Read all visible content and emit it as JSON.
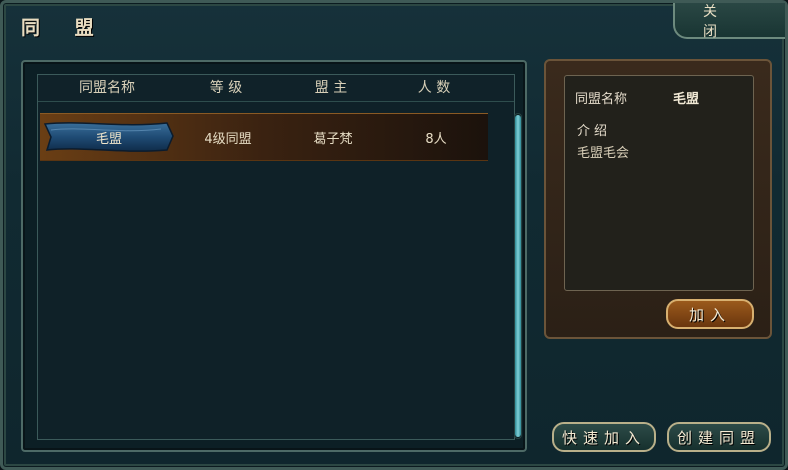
{
  "window": {
    "title": "同 盟"
  },
  "close_button": {
    "label": "关 闭"
  },
  "list": {
    "columns": [
      "同盟名称",
      "等 级",
      "盟 主",
      "人 数"
    ],
    "rows": [
      {
        "name": "毛盟",
        "level": "4级同盟",
        "leader": "葛子梵",
        "members": "8人"
      }
    ]
  },
  "detail": {
    "name_label": "同盟名称",
    "name_value": "毛盟",
    "intro_label": "介绍",
    "intro_text": "毛盟毛会"
  },
  "buttons": {
    "join": "加入",
    "quick_join": "快速加入",
    "create": "创建同盟"
  },
  "colors": {
    "selected_row": "#6a3e14",
    "scrollbar": "#7fd0d8",
    "gold_button": "#9b5a1c"
  }
}
